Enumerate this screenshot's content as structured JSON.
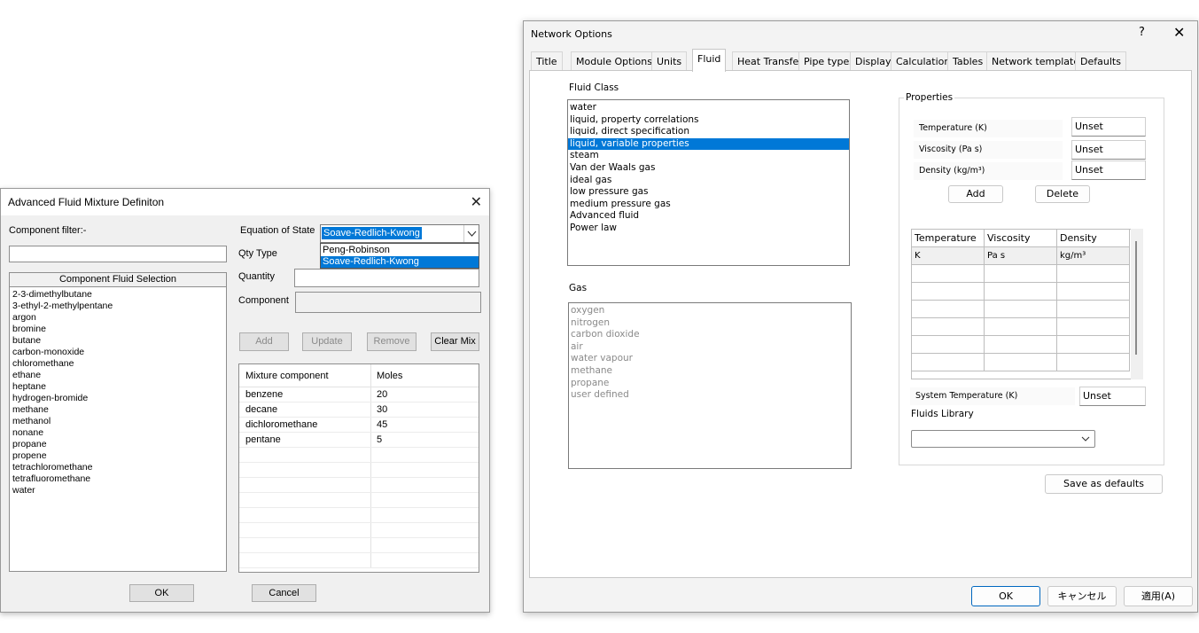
{
  "left_dialog": {
    "title": "Advanced Fluid Mixture Definiton",
    "close_glyph": "✕",
    "component_filter_label": "Component filter:-",
    "component_filter_value": "",
    "component_header": "Component Fluid Selection",
    "components": [
      "2-3-dimethylbutane",
      "3-ethyl-2-methylpentane",
      "argon",
      "bromine",
      "butane",
      "carbon-monoxide",
      "chloromethane",
      "ethane",
      "heptane",
      "hydrogen-bromide",
      "methane",
      "methanol",
      "nonane",
      "propane",
      "propene",
      "tetrachloromethane",
      "tetrafluoromethane",
      "water"
    ],
    "eos_label": "Equation of State",
    "eos_value": "Soave-Redlich-Kwong",
    "eos_options": [
      "Peng-Robinson",
      "Soave-Redlich-Kwong"
    ],
    "eos_selected_option": "Soave-Redlich-Kwong",
    "qty_type_label": "Qty Type",
    "quantity_label": "Quantity",
    "component_label": "Component",
    "buttons": {
      "add": "Add",
      "update": "Update",
      "remove": "Remove",
      "clear_mix": "Clear Mix",
      "ok": "OK",
      "cancel": "Cancel"
    },
    "mixture_table": {
      "headers": [
        "Mixture component",
        "Moles"
      ],
      "rows": [
        [
          "benzene",
          "20"
        ],
        [
          "decane",
          "30"
        ],
        [
          "dichloromethane",
          "45"
        ],
        [
          "pentane",
          "5"
        ]
      ]
    }
  },
  "right_dialog": {
    "title": "Network Options",
    "help_glyph": "?",
    "close_glyph": "✕",
    "tabs": [
      "Title",
      "Module Options",
      "Units",
      "Fluid",
      "Heat Transfer",
      "Pipe types",
      "Display",
      "Calculation",
      "Tables",
      "Network templates",
      "Defaults"
    ],
    "active_tab": "Fluid",
    "fluid_class_label": "Fluid Class",
    "fluid_classes": [
      "water",
      "liquid, property correlations",
      "liquid, direct specification",
      "liquid, variable properties",
      "steam",
      "Van der Waals gas",
      "ideal gas",
      "low pressure gas",
      "medium pressure gas",
      "Advanced fluid",
      "Power law"
    ],
    "selected_fluid_class": "liquid, variable properties",
    "gas_label": "Gas",
    "gases": [
      "oxygen",
      "nitrogen",
      "carbon dioxide",
      "air",
      "water vapour",
      "methane",
      "propane",
      "user defined"
    ],
    "properties": {
      "group_label": "Properties",
      "temperature_label": "Temperature (K)",
      "temperature_value": "Unset",
      "viscosity_label": "Viscosity (Pa s)",
      "viscosity_value": "Unset",
      "density_label": "Density (kg/m³)",
      "density_value": "Unset",
      "add_label": "Add",
      "delete_label": "Delete",
      "table_headers": [
        "Temperature",
        "Viscosity",
        "Density"
      ],
      "table_units": [
        "K",
        "Pa s",
        "kg/m³"
      ],
      "system_temperature_label": "System Temperature (K)",
      "system_temperature_value": "Unset",
      "fluids_library_label": "Fluids Library",
      "fluids_library_value": ""
    },
    "save_defaults_label": "Save as defaults",
    "footer": {
      "ok": "OK",
      "cancel": "キャンセル",
      "apply": "適用(A)"
    }
  }
}
